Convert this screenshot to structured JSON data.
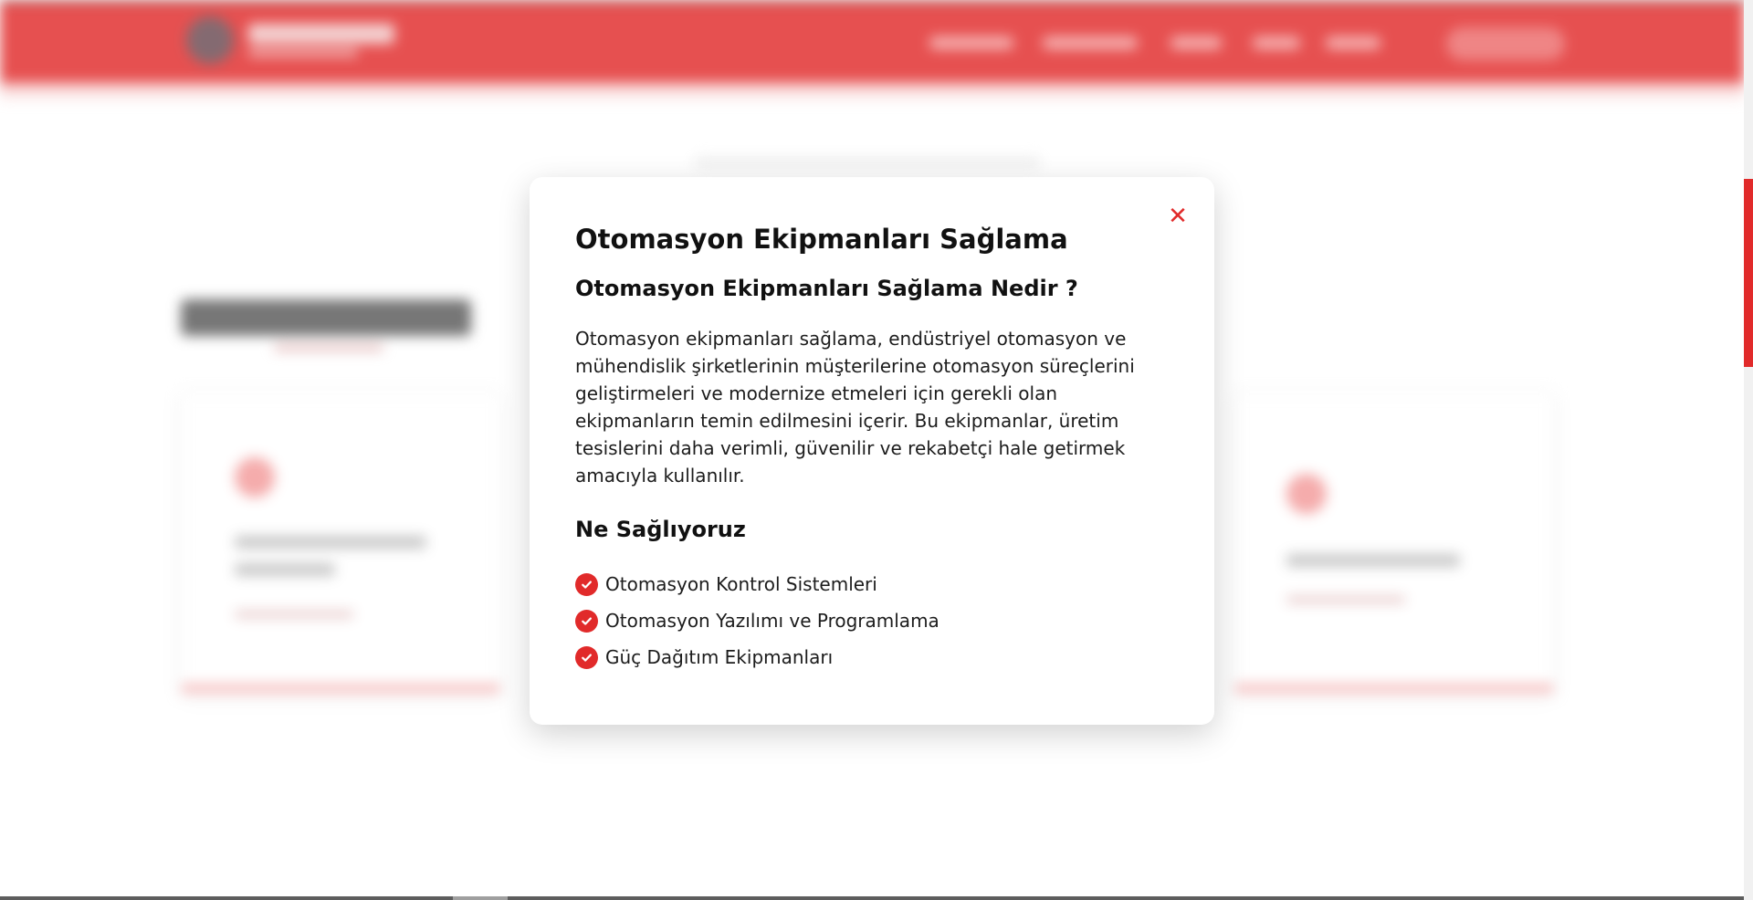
{
  "modal": {
    "title": "Otomasyon Ekipmanları Sağlama",
    "subtitle": "Otomasyon Ekipmanları Sağlama Nedir ?",
    "description": "Otomasyon ekipmanları sağlama, endüstriyel otomasyon ve mühendislik şirketlerinin müşterilerine otomasyon süreçlerini geliştirmeleri ve modernize etmeleri için gerekli olan ekipmanların temin edilmesini içerir. Bu ekipmanlar, üretim tesislerini daha verimli, güvenilir ve rekabetçi hale getirmek amacıyla kullanılır.",
    "section_title": "Ne Sağlıyoruz",
    "features": [
      "Otomasyon Kontrol Sistemleri",
      "Otomasyon Yazılımı ve Programlama",
      "Güç Dağıtım Ekipmanları"
    ],
    "close_symbol": "✕",
    "feature_icon": "check-circle-icon"
  },
  "colors": {
    "accent": "#e12a2a",
    "modal_bg": "#ffffff",
    "text": "#111111"
  }
}
